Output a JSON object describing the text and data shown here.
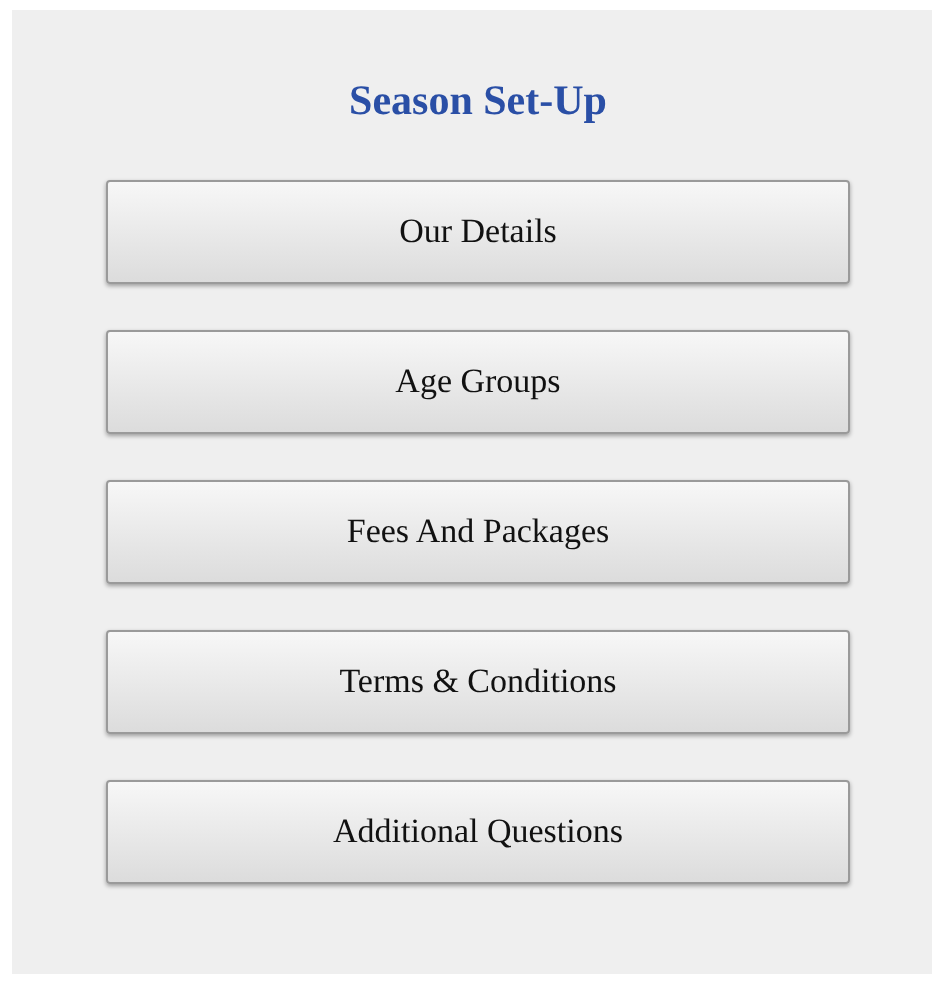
{
  "title": "Season Set-Up",
  "buttons": [
    "Our Details",
    "Age Groups",
    "Fees And Packages",
    "Terms & Conditions",
    "Additional Questions"
  ]
}
